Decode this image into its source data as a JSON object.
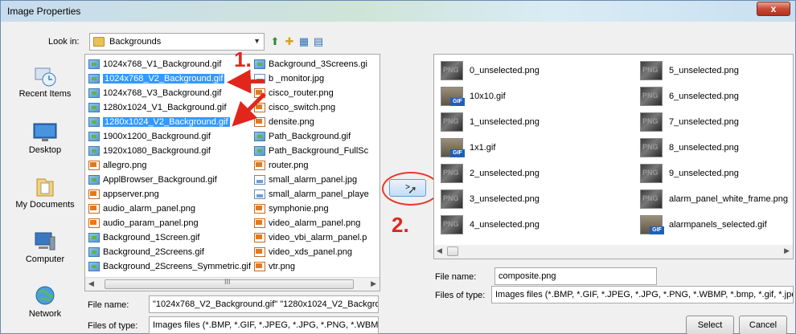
{
  "window": {
    "title": "Image Properties",
    "close": "x"
  },
  "lookin": {
    "label": "Look in:",
    "value": "Backgrounds"
  },
  "places": [
    {
      "label": "Recent Items",
      "icon": "recent-items-icon"
    },
    {
      "label": "Desktop",
      "icon": "desktop-icon"
    },
    {
      "label": "My Documents",
      "icon": "my-documents-icon"
    },
    {
      "label": "Computer",
      "icon": "computer-icon"
    },
    {
      "label": "Network",
      "icon": "network-icon"
    }
  ],
  "files_col1": [
    {
      "name": "1024x768_V1_Background.gif",
      "type": "gif",
      "selected": false
    },
    {
      "name": "1024x768_V2_Background.gif",
      "type": "gif",
      "selected": true
    },
    {
      "name": "1024x768_V3_Background.gif",
      "type": "gif",
      "selected": false
    },
    {
      "name": "1280x1024_V1_Background.gif",
      "type": "gif",
      "selected": false
    },
    {
      "name": "1280x1024_V2_Background.gif",
      "type": "gif",
      "selected": true
    },
    {
      "name": "1900x1200_Background.gif",
      "type": "gif",
      "selected": false
    },
    {
      "name": "1920x1080_Background.gif",
      "type": "gif",
      "selected": false
    },
    {
      "name": "allegro.png",
      "type": "png",
      "selected": false
    },
    {
      "name": "ApplBrowser_Background.gif",
      "type": "gif",
      "selected": false
    },
    {
      "name": "appserver.png",
      "type": "png",
      "selected": false
    },
    {
      "name": "audio_alarm_panel.png",
      "type": "png",
      "selected": false
    },
    {
      "name": "audio_param_panel.png",
      "type": "png",
      "selected": false
    },
    {
      "name": "Background_1Screen.gif",
      "type": "gif",
      "selected": false
    },
    {
      "name": "Background_2Screens.gif",
      "type": "gif",
      "selected": false
    },
    {
      "name": "Background_2Screens_Symmetric.gif",
      "type": "gif",
      "selected": false
    }
  ],
  "files_col2": [
    {
      "name": "Background_3Screens.gi",
      "type": "gif"
    },
    {
      "name": "b   _monitor.jpg",
      "type": "jpg"
    },
    {
      "name": "cisco_router.png",
      "type": "png"
    },
    {
      "name": "cisco_switch.png",
      "type": "png"
    },
    {
      "name": "densite.png",
      "type": "png"
    },
    {
      "name": "Path_Background.gif",
      "type": "gif"
    },
    {
      "name": "Path_Background_FullSc",
      "type": "gif"
    },
    {
      "name": "router.png",
      "type": "png"
    },
    {
      "name": "small_alarm_panel.jpg",
      "type": "jpg"
    },
    {
      "name": "small_alarm_panel_playe",
      "type": "jpg"
    },
    {
      "name": "symphonie.png",
      "type": "png"
    },
    {
      "name": "video_alarm_panel.png",
      "type": "png"
    },
    {
      "name": "video_vbi_alarm_panel.p",
      "type": "png"
    },
    {
      "name": "video_xds_panel.png",
      "type": "png"
    },
    {
      "name": "vtr.png",
      "type": "png"
    }
  ],
  "left_scroll": {
    "grip": "III"
  },
  "left_fields": {
    "filename_label": "File name:",
    "filename_value": "\"1024x768_V2_Background.gif\" \"1280x1024_V2_Backgroun",
    "filetype_label": "Files of type:",
    "filetype_value": "Images files (*.BMP, *.GIF, *.JPEG, *.JPG, *.PNG, *.WBMP"
  },
  "move_button": {
    "label": ">"
  },
  "steps": {
    "one": "1.",
    "two": "2."
  },
  "right_col1": [
    {
      "name": "0_unselected.png",
      "kind": "png"
    },
    {
      "name": "10x10.gif",
      "kind": "gif"
    },
    {
      "name": "1_unselected.png",
      "kind": "png"
    },
    {
      "name": "1x1.gif",
      "kind": "gif"
    },
    {
      "name": "2_unselected.png",
      "kind": "png"
    },
    {
      "name": "3_unselected.png",
      "kind": "png"
    },
    {
      "name": "4_unselected.png",
      "kind": "png"
    }
  ],
  "right_col2": [
    {
      "name": "5_unselected.png",
      "kind": "png"
    },
    {
      "name": "6_unselected.png",
      "kind": "png"
    },
    {
      "name": "7_unselected.png",
      "kind": "png"
    },
    {
      "name": "8_unselected.png",
      "kind": "png"
    },
    {
      "name": "9_unselected.png",
      "kind": "png"
    },
    {
      "name": "alarm_panel_white_frame.png",
      "kind": "png"
    },
    {
      "name": "alarmpanels_selected.gif",
      "kind": "gif"
    }
  ],
  "gif_badge": "GIF",
  "right_fields": {
    "filename_label": "File name:",
    "filename_value": "composite.png",
    "filetype_label": "Files of type:",
    "filetype_value": "Images files (*.BMP, *.GIF, *.JPEG, *.JPG, *.PNG, *.WBMP, *.bmp, *.gif, *.jpeg"
  },
  "buttons": {
    "select": "Select",
    "cancel": "Cancel"
  },
  "colors": {
    "accent_red": "#e1261c",
    "selection": "#3399ff"
  }
}
